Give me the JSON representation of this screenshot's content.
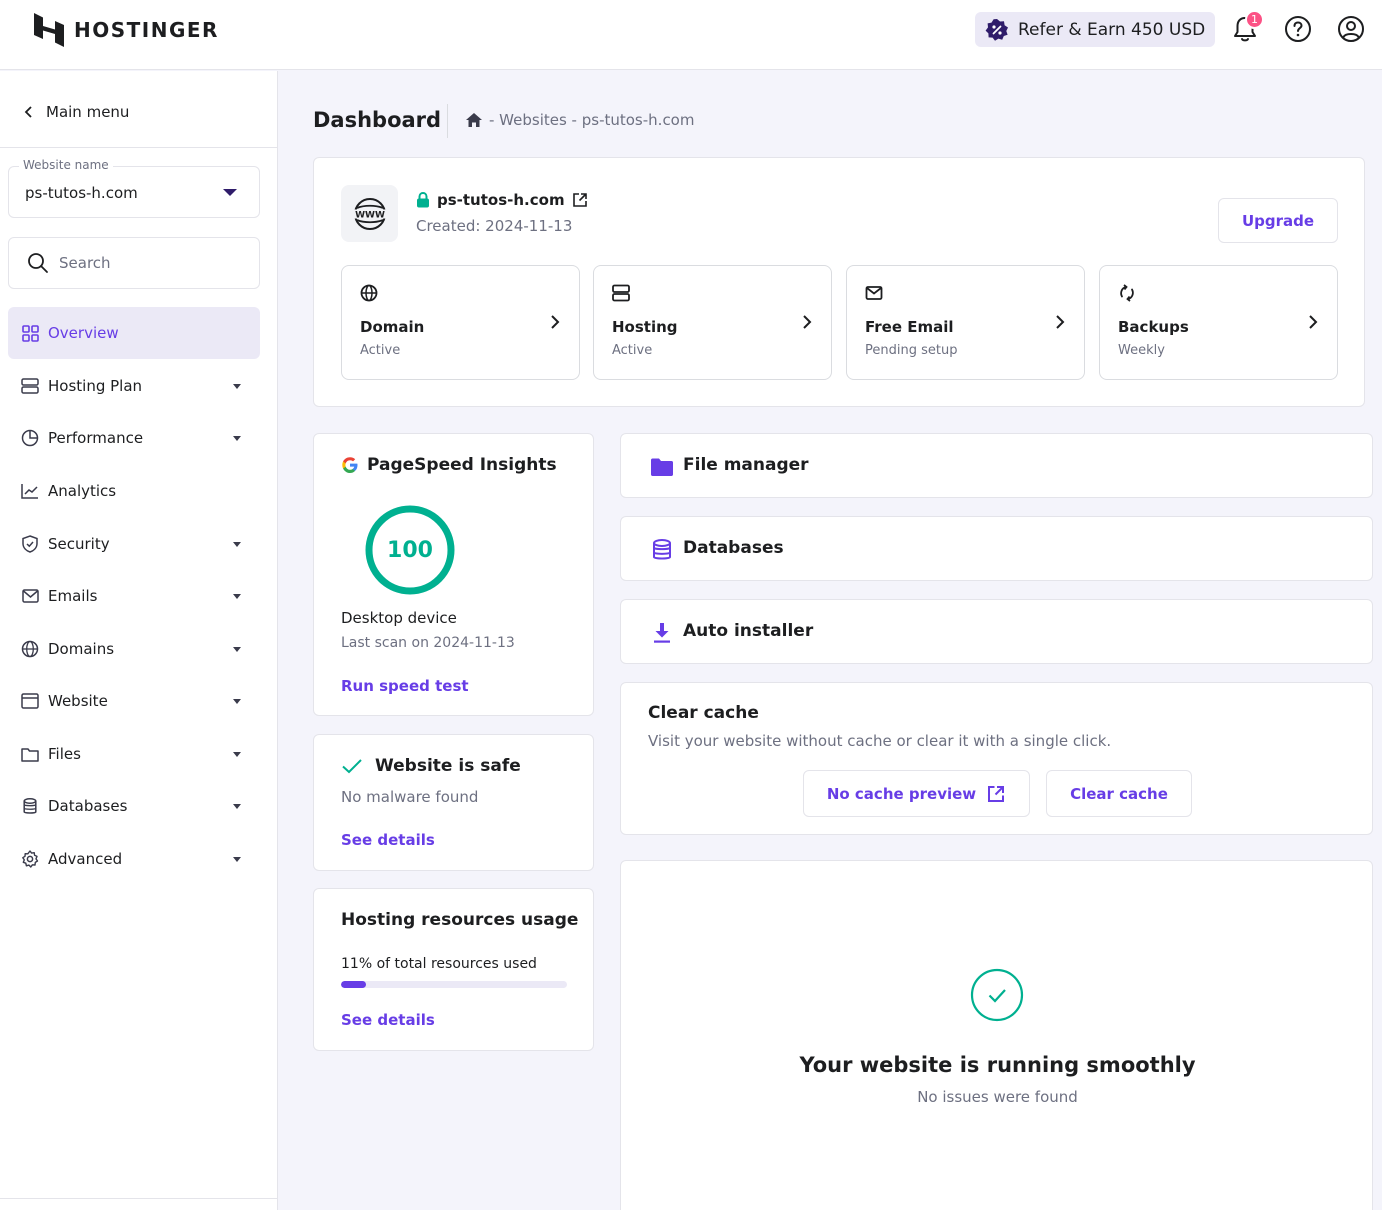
{
  "header": {
    "brand": "HOSTINGER",
    "refer_label": "Refer & Earn 450 USD",
    "notification_count": "1"
  },
  "sidebar": {
    "main_menu_label": "Main menu",
    "website_name_label": "Website name",
    "website_name_value": "ps-tutos-h.com",
    "search_placeholder": "Search",
    "items": [
      {
        "label": "Overview",
        "icon": "overview-grid-icon",
        "active": true
      },
      {
        "label": "Hosting Plan",
        "icon": "server-icon"
      },
      {
        "label": "Performance",
        "icon": "pie-chart-icon"
      },
      {
        "label": "Analytics",
        "icon": "line-chart-icon"
      },
      {
        "label": "Security",
        "icon": "shield-icon"
      },
      {
        "label": "Emails",
        "icon": "mail-icon"
      },
      {
        "label": "Domains",
        "icon": "globe-icon"
      },
      {
        "label": "Website",
        "icon": "browser-window-icon"
      },
      {
        "label": "Files",
        "icon": "folder-icon"
      },
      {
        "label": "Databases",
        "icon": "database-icon"
      },
      {
        "label": "Advanced",
        "icon": "gear-icon"
      }
    ]
  },
  "main": {
    "page_title": "Dashboard",
    "breadcrumb": "- Websites - ps-tutos-h.com",
    "summary": {
      "domain": "ps-tutos-h.com",
      "created": "Created: 2024-11-13",
      "upgrade_label": "Upgrade",
      "tiles": [
        {
          "title": "Domain",
          "status": "Active",
          "icon": "globe-icon"
        },
        {
          "title": "Hosting",
          "status": "Active",
          "icon": "server-icon"
        },
        {
          "title": "Free Email",
          "status": "Pending setup",
          "icon": "mail-icon"
        },
        {
          "title": "Backups",
          "status": "Weekly",
          "icon": "refresh-icon"
        }
      ]
    },
    "pagespeed": {
      "title": "PageSpeed Insights",
      "score": "100",
      "device": "Desktop device",
      "last_scan": "Last scan on 2024-11-13",
      "run_label": "Run speed test"
    },
    "safety": {
      "title": "Website is safe",
      "subtitle": "No malware found",
      "link_label": "See details"
    },
    "resources": {
      "title": "Hosting resources usage",
      "text": "11% of total resources used",
      "percent": 11,
      "link_label": "See details"
    },
    "tools": [
      {
        "label": "File manager",
        "icon": "folder-icon"
      },
      {
        "label": "Databases",
        "icon": "database-icon"
      },
      {
        "label": "Auto installer",
        "icon": "download-icon"
      }
    ],
    "cache": {
      "title": "Clear cache",
      "subtitle": "Visit your website without cache or clear it with a single click.",
      "preview_label": "No cache preview",
      "clear_label": "Clear cache"
    },
    "status": {
      "title": "Your website is running smoothly",
      "subtitle": "No issues were found"
    }
  },
  "colors": {
    "accent": "#673de6",
    "success": "#00b090",
    "badge": "#fc5185",
    "background": "#f4f4fb"
  }
}
